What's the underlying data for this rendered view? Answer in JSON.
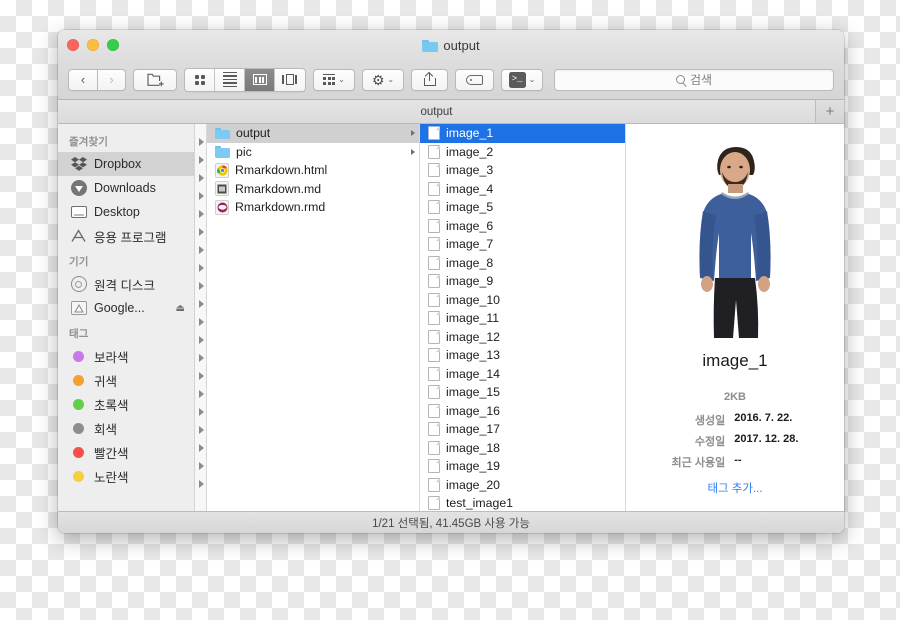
{
  "window": {
    "title": "output",
    "traffic_lights": [
      "close",
      "minimize",
      "zoom"
    ]
  },
  "toolbar": {
    "back_label": "‹",
    "forward_label": "›",
    "new_folder_label": "new-folder",
    "view_icon_label": "icon-view",
    "view_list_label": "list-view",
    "view_column_label": "column-view",
    "view_gallery_label": "gallery-view",
    "arrange_label": "arrange",
    "action_label": "⚙",
    "share_label": "share",
    "tag_label": "tag",
    "terminal_label": ">_",
    "caret": "⌄"
  },
  "search": {
    "placeholder": "검색"
  },
  "tabs": {
    "items": [
      {
        "label": "output",
        "active": true
      }
    ],
    "add_label": "+"
  },
  "sidebar": {
    "sections": [
      {
        "header": "즐겨찾기",
        "items": [
          {
            "label": "Dropbox",
            "icon": "dropbox-icon",
            "selected": true
          },
          {
            "label": "Downloads",
            "icon": "download-icon",
            "selected": false
          },
          {
            "label": "Desktop",
            "icon": "desktop-icon",
            "selected": false
          },
          {
            "label": "응용 프로그램",
            "icon": "applications-icon",
            "selected": false
          }
        ]
      },
      {
        "header": "기기",
        "items": [
          {
            "label": "원격 디스크",
            "icon": "disc-icon",
            "selected": false
          },
          {
            "label": "Google...",
            "icon": "drive-icon",
            "selected": false,
            "eject": "⏏"
          }
        ]
      },
      {
        "header": "태그",
        "items": [
          {
            "label": "보라색",
            "icon": "tag-dot",
            "color": "#c878e8"
          },
          {
            "label": "귀색",
            "icon": "tag-dot",
            "color": "#f4a02f"
          },
          {
            "label": "초록색",
            "icon": "tag-dot",
            "color": "#5fd04a"
          },
          {
            "label": "회색",
            "icon": "tag-dot",
            "color": "#8e8e8e"
          },
          {
            "label": "빨간색",
            "icon": "tag-dot",
            "color": "#f7504a"
          },
          {
            "label": "노란색",
            "icon": "tag-dot",
            "color": "#f6cf3c"
          }
        ]
      }
    ]
  },
  "column_one": {
    "items": [
      {
        "label": "output",
        "icon": "folder-icon",
        "selected": true,
        "disclosure": true
      },
      {
        "label": "pic",
        "icon": "folder-icon",
        "selected": false,
        "disclosure": true
      },
      {
        "label": "Rmarkdown.html",
        "icon": "chrome-icon",
        "selected": false,
        "disclosure": false
      },
      {
        "label": "Rmarkdown.md",
        "icon": "markdown-icon",
        "selected": false,
        "disclosure": false
      },
      {
        "label": "Rmarkdown.rmd",
        "icon": "rstudio-icon",
        "selected": false,
        "disclosure": false
      }
    ]
  },
  "column_two": {
    "items": [
      {
        "label": "image_1",
        "selected": true
      },
      {
        "label": "image_2",
        "selected": false
      },
      {
        "label": "image_3",
        "selected": false
      },
      {
        "label": "image_4",
        "selected": false
      },
      {
        "label": "image_5",
        "selected": false
      },
      {
        "label": "image_6",
        "selected": false
      },
      {
        "label": "image_7",
        "selected": false
      },
      {
        "label": "image_8",
        "selected": false
      },
      {
        "label": "image_9",
        "selected": false
      },
      {
        "label": "image_10",
        "selected": false
      },
      {
        "label": "image_11",
        "selected": false
      },
      {
        "label": "image_12",
        "selected": false
      },
      {
        "label": "image_13",
        "selected": false
      },
      {
        "label": "image_14",
        "selected": false
      },
      {
        "label": "image_15",
        "selected": false
      },
      {
        "label": "image_16",
        "selected": false
      },
      {
        "label": "image_17",
        "selected": false
      },
      {
        "label": "image_18",
        "selected": false
      },
      {
        "label": "image_19",
        "selected": false
      },
      {
        "label": "image_20",
        "selected": false
      },
      {
        "label": "test_image1",
        "selected": false
      }
    ]
  },
  "preview": {
    "image_alt": "man-in-blue-sweater-photo",
    "title": "image_1",
    "size": "2KB",
    "fields": [
      {
        "key": "생성일",
        "value": "2016. 7. 22."
      },
      {
        "key": "수정일",
        "value": "2017. 12. 28."
      },
      {
        "key": "최근 사용일",
        "value": "--"
      }
    ],
    "add_tag_label": "태그 추가..."
  },
  "status": {
    "text": "1/21 선택됨, 41.45GB 사용 가능"
  },
  "colors": {
    "selection_blue": "#1f72e5",
    "link_blue": "#2e7fe8",
    "folder_blue": "#7ccbf2",
    "traffic_red": "#f9655b",
    "traffic_yellow": "#fcbc40",
    "traffic_green": "#35cd4b"
  }
}
